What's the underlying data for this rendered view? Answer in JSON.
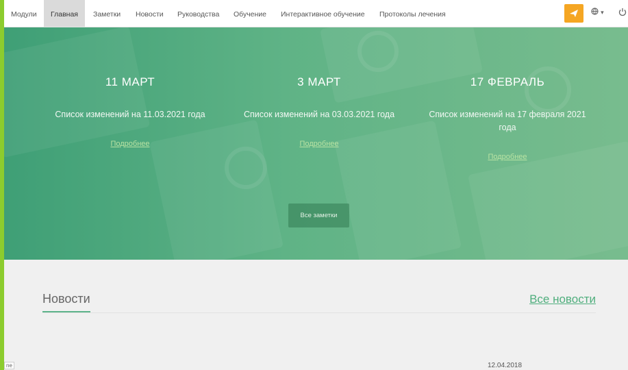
{
  "nav": {
    "items": [
      {
        "label": "Модули"
      },
      {
        "label": "Главная"
      },
      {
        "label": "Заметки"
      },
      {
        "label": "Новости"
      },
      {
        "label": "Руководства"
      },
      {
        "label": "Обучение"
      },
      {
        "label": "Интерактивное обучение"
      },
      {
        "label": "Протоколы лечения"
      }
    ],
    "active_index": 1,
    "icons": [
      "send-icon",
      "globe-icon",
      "power-icon"
    ],
    "globe_dropdown": "▾"
  },
  "hero": {
    "columns": [
      {
        "date": "11 МАРТ",
        "description": "Список изменений на 11.03.2021 года",
        "link": "Подробнее"
      },
      {
        "date": "3 МАРТ",
        "description": "Список изменений на 03.03.2021 года",
        "link": "Подробнее"
      },
      {
        "date": "17 ФЕВРАЛЬ",
        "description": "Список изменений на 17 февраля 2021 года",
        "link": "Подробнее"
      }
    ],
    "all_notes_label": "Все заметки"
  },
  "news_section": {
    "title": "Новости",
    "all_link": "Все новости",
    "first_item_date": "12.04.2018"
  },
  "left_tag": "ne",
  "colors": {
    "accent": "#8ccc2e",
    "hero_green": "#5fb386",
    "send_button": "#f5a623",
    "link_green": "#4fae7d"
  }
}
